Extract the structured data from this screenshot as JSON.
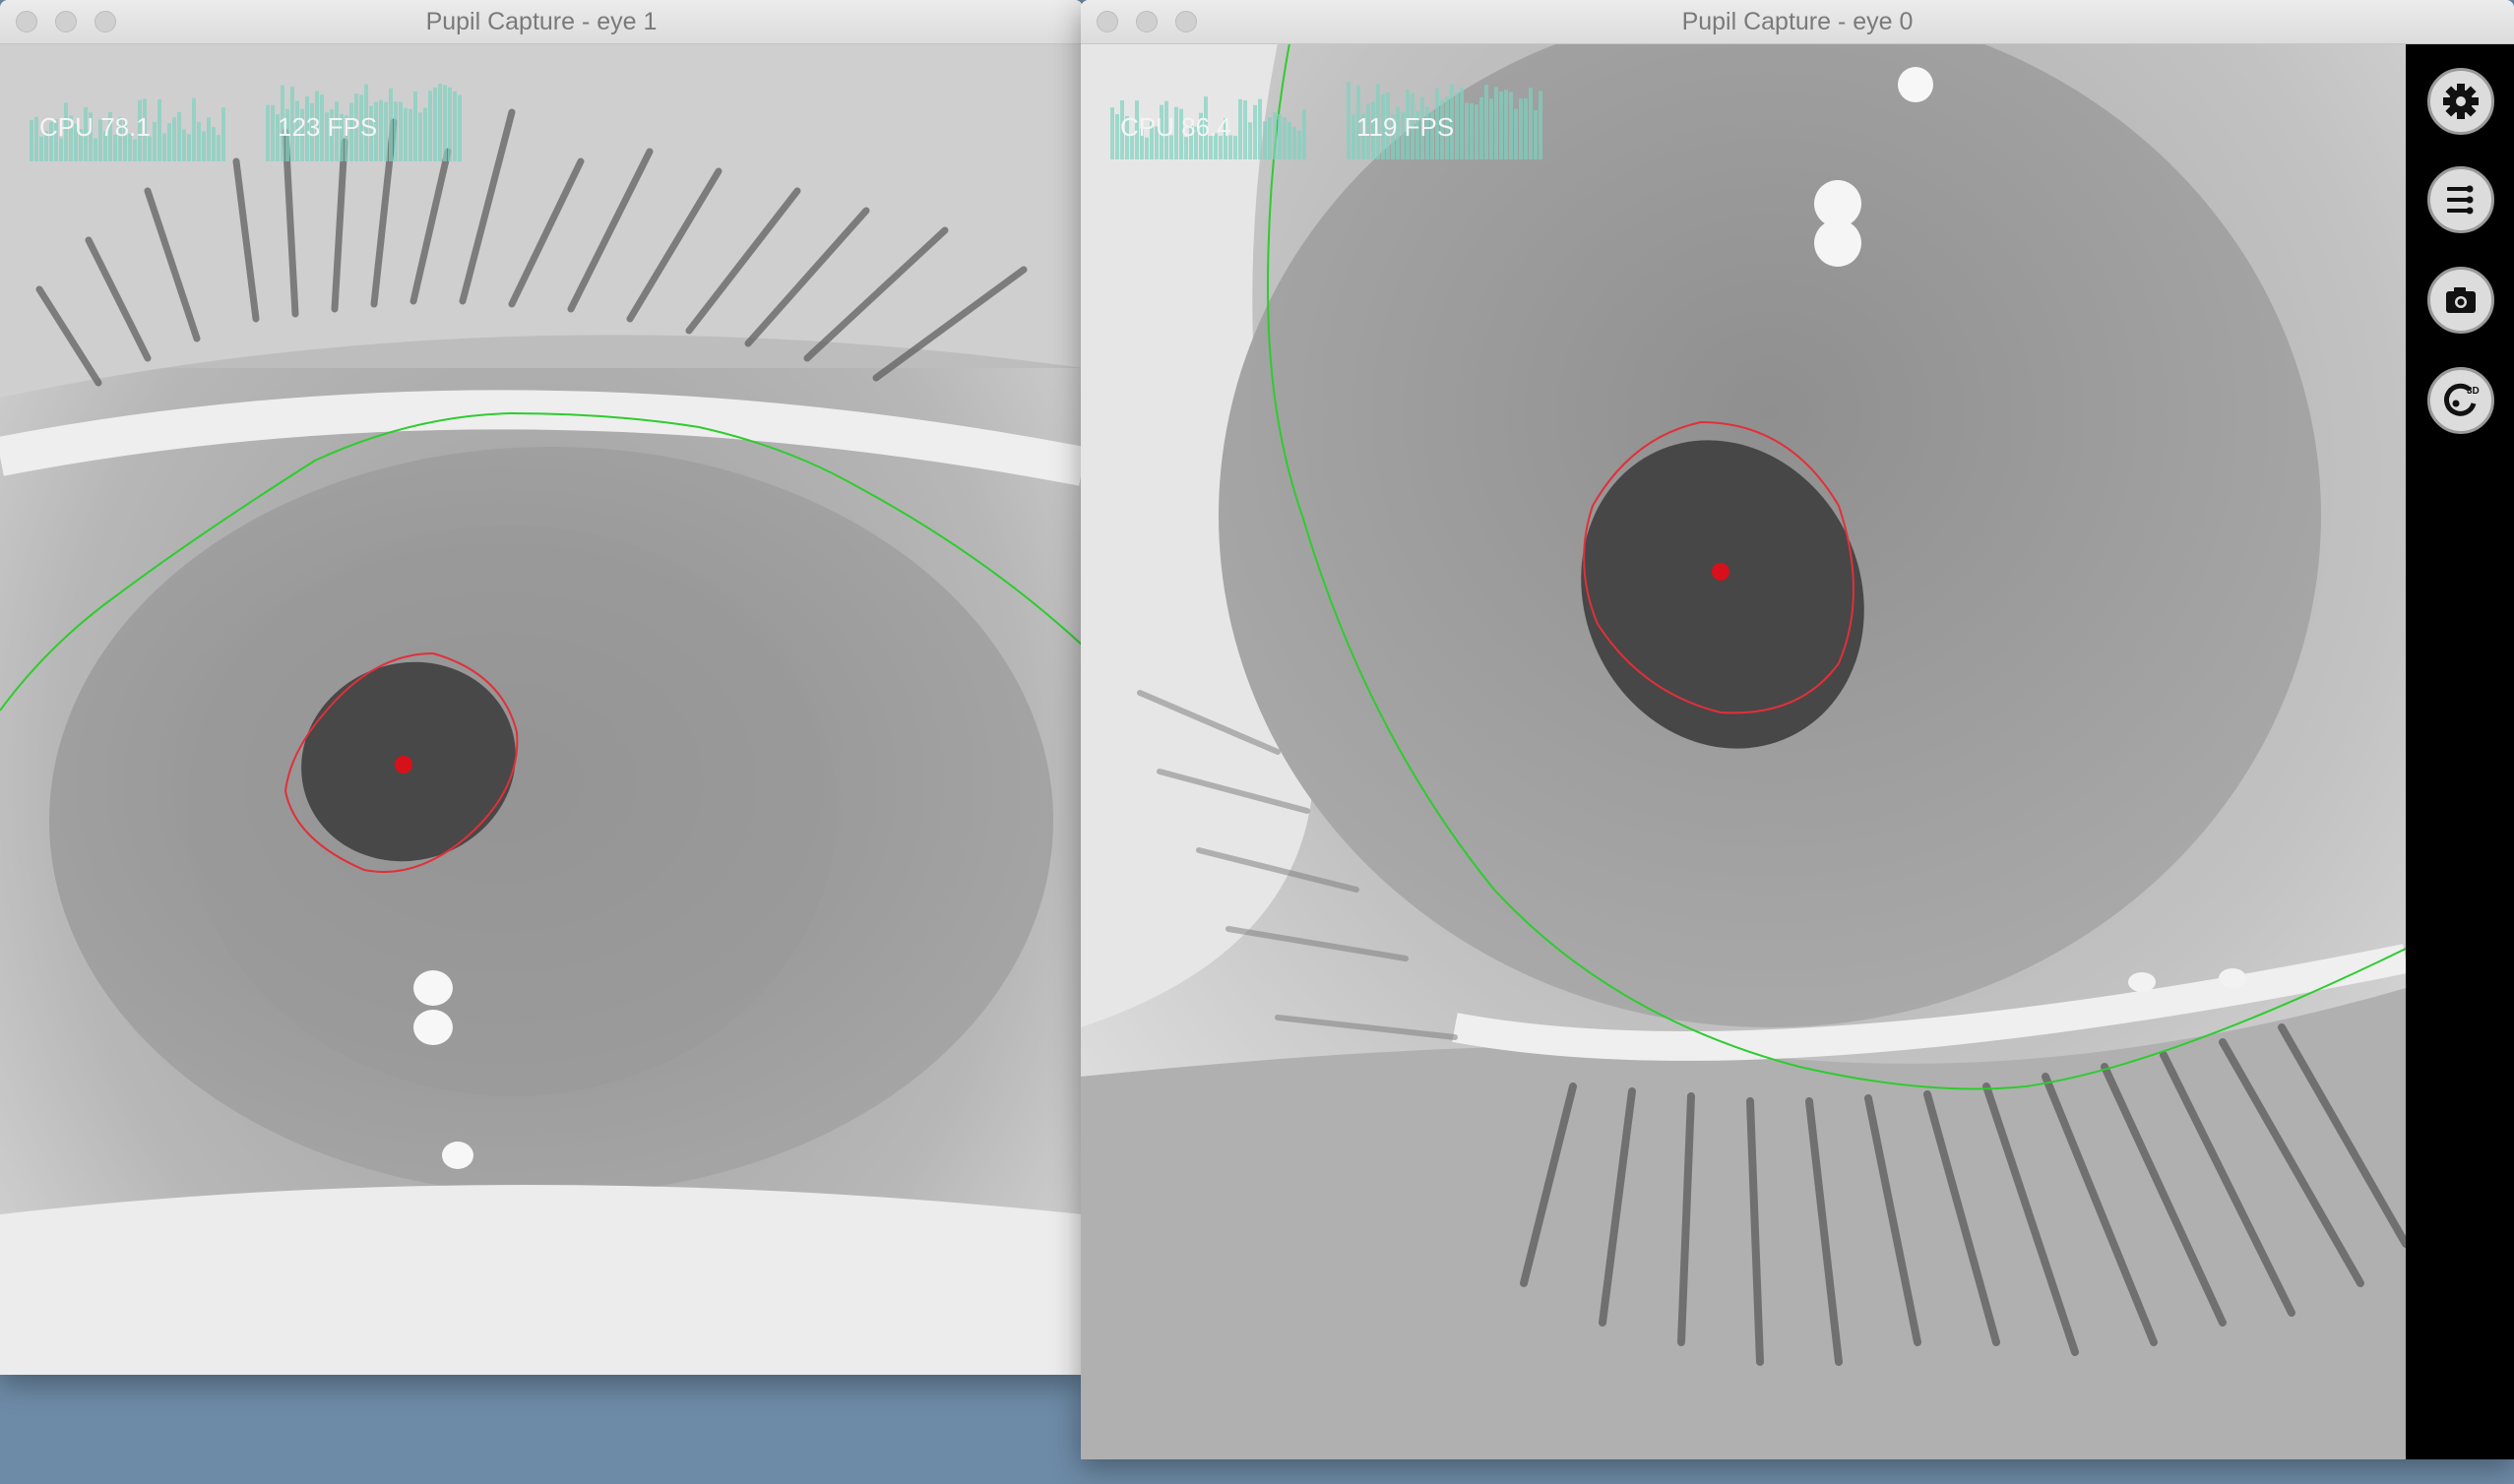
{
  "windows": {
    "eye1": {
      "title": "Pupil Capture - eye 1",
      "cpu_label": "CPU 78.1",
      "fps_label": "123 FPS"
    },
    "eye0": {
      "title": "Pupil Capture - eye 0",
      "cpu_label": "CPU 86.4",
      "fps_label": "119 FPS"
    }
  },
  "sidebar": {
    "buttons": [
      {
        "name": "settings",
        "icon": "gear-icon"
      },
      {
        "name": "plugins",
        "icon": "menu-list-icon"
      },
      {
        "name": "capture",
        "icon": "camera-icon"
      },
      {
        "name": "eye-model-3d",
        "icon": "3d-eye-model-icon",
        "label": "3D"
      }
    ]
  },
  "colors": {
    "pupil_outline": "#e0303a",
    "pupil_center": "#d8101a",
    "eye_model": "#2ecc2e",
    "hud_graph": "#7fd1bf",
    "desktop": "#6d8aa6"
  }
}
